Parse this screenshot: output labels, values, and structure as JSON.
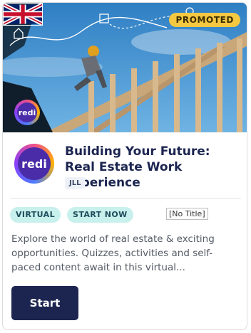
{
  "hero": {
    "badge": "PROMOTED",
    "logo_text": "redi"
  },
  "card": {
    "logo_text": "redi",
    "title": "Building Your Future: Real Estate Work Experience",
    "company": "JLL",
    "tags": [
      "VIRTUAL",
      "START NOW"
    ],
    "tooltip": "[No Title]",
    "description": "Explore the world of real estate & exciting opportunities. Quizzes, activities and self-paced content await in this virtual...",
    "button_label": "Start"
  },
  "colors": {
    "accent_navy": "#1c2550",
    "tag_bg": "#c8f0ec",
    "badge_bg": "#f5c842"
  }
}
